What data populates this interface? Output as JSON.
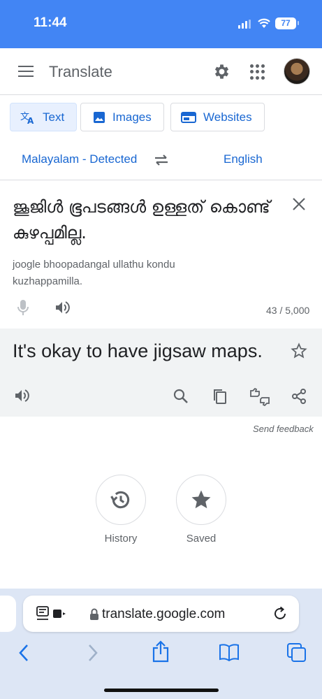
{
  "status_bar": {
    "time": "11:44",
    "battery": "77"
  },
  "app_bar": {
    "title": "Translate"
  },
  "mode_tabs": [
    {
      "label": "Text",
      "active": true
    },
    {
      "label": "Images",
      "active": false
    },
    {
      "label": "Websites",
      "active": false
    }
  ],
  "languages": {
    "source": "Malayalam - Detected",
    "target": "English"
  },
  "source": {
    "text": "ജൂജിൾ ഭൂപടങ്ങൾ ഉള്ളത് കൊണ്ട് കുഴപ്പമില്ല.",
    "transliteration": "joogle bhoopadangal ullathu kondu kuzhappamilla.",
    "char_count": "43 / 5,000"
  },
  "target": {
    "text": "It's okay to have jigsaw maps."
  },
  "feedback": {
    "label": "Send feedback"
  },
  "history": {
    "label": "History"
  },
  "saved": {
    "label": "Saved"
  },
  "browser": {
    "url": "translate.google.com"
  },
  "colors": {
    "status_bar": "#4285f4",
    "accent": "#1967d2",
    "browser_bar": "#dde6f5"
  }
}
